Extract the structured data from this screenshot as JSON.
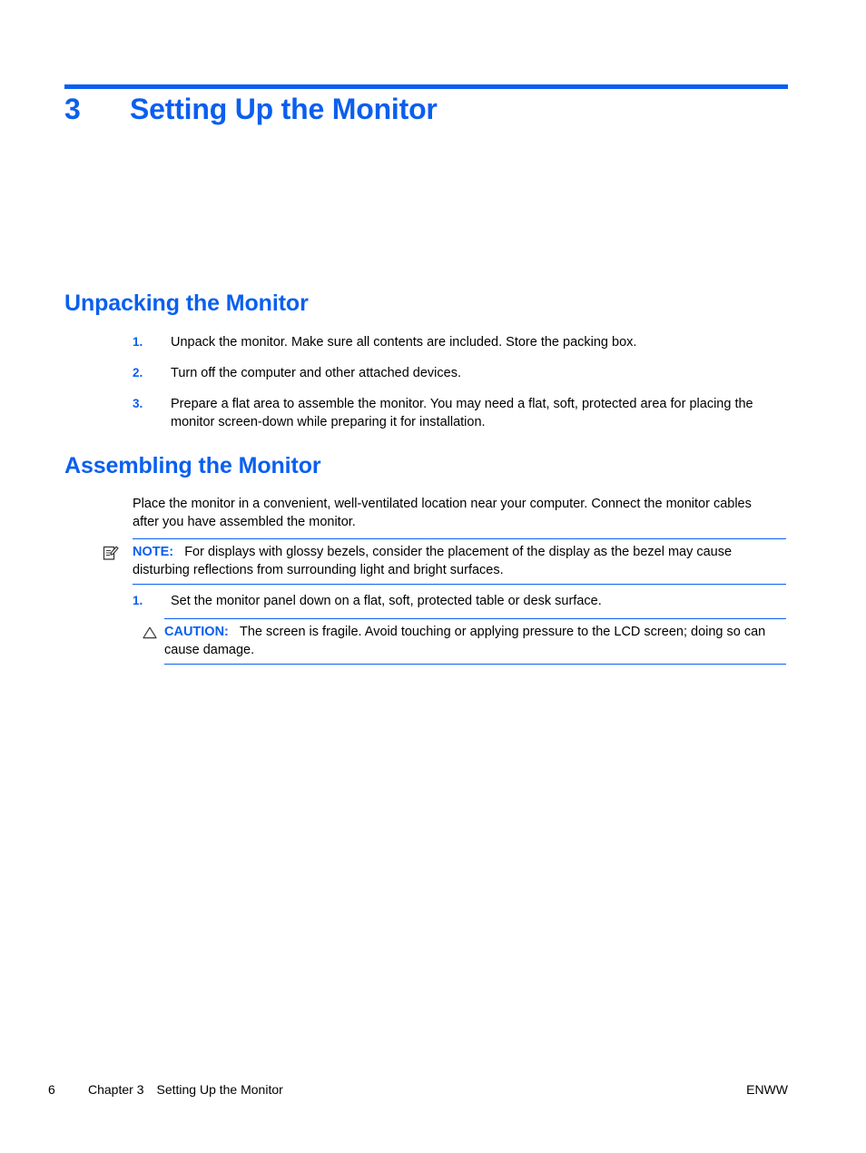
{
  "chapter": {
    "number": "3",
    "title": "Setting Up the Monitor"
  },
  "sections": {
    "unpacking": {
      "heading": "Unpacking the Monitor",
      "steps": [
        {
          "marker": "1.",
          "text": "Unpack the monitor. Make sure all contents are included. Store the packing box."
        },
        {
          "marker": "2.",
          "text": "Turn off the computer and other attached devices."
        },
        {
          "marker": "3.",
          "text": "Prepare a flat area to assemble the monitor. You may need a flat, soft, protected area for placing the monitor screen-down while preparing it for installation."
        }
      ]
    },
    "assembling": {
      "heading": "Assembling the Monitor",
      "intro": "Place the monitor in a convenient, well-ventilated location near your computer. Connect the monitor cables after you have assembled the monitor.",
      "note": {
        "icon": "note-pencil-icon",
        "label": "NOTE:",
        "text": "For displays with glossy bezels, consider the placement of the display as the bezel may cause disturbing reflections from surrounding light and bright surfaces."
      },
      "steps": [
        {
          "marker": "1.",
          "text": "Set the monitor panel down on a flat, soft, protected table or desk surface."
        }
      ],
      "caution": {
        "icon": "warning-triangle-icon",
        "label": "CAUTION:",
        "text": "The screen is fragile. Avoid touching or applying pressure to the LCD screen; doing so can cause damage."
      }
    }
  },
  "footer": {
    "page_number": "6",
    "chapter_label": "Chapter 3",
    "chapter_title": "Setting Up the Monitor",
    "locale_code": "ENWW"
  },
  "colors": {
    "accent_blue": "#0a5fef",
    "text_black": "#000000",
    "page_background": "#ffffff"
  }
}
